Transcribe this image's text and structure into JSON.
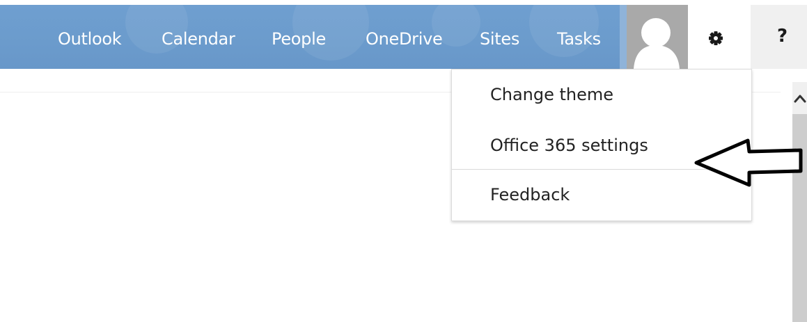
{
  "nav": {
    "items": [
      {
        "label": "Outlook"
      },
      {
        "label": "Calendar"
      },
      {
        "label": "People"
      },
      {
        "label": "OneDrive"
      },
      {
        "label": "Sites"
      },
      {
        "label": "Tasks"
      }
    ],
    "bar_color": "#6b9bcc"
  },
  "header": {
    "avatar_icon": "person-silhouette-icon",
    "settings_icon": "gear-icon",
    "help_label": "?"
  },
  "settings_menu": {
    "items": [
      {
        "label": "Change theme"
      },
      {
        "label": "Office 365 settings"
      },
      {
        "label": "Feedback"
      }
    ]
  },
  "annotation": {
    "icon": "left-arrow-outline-icon"
  }
}
